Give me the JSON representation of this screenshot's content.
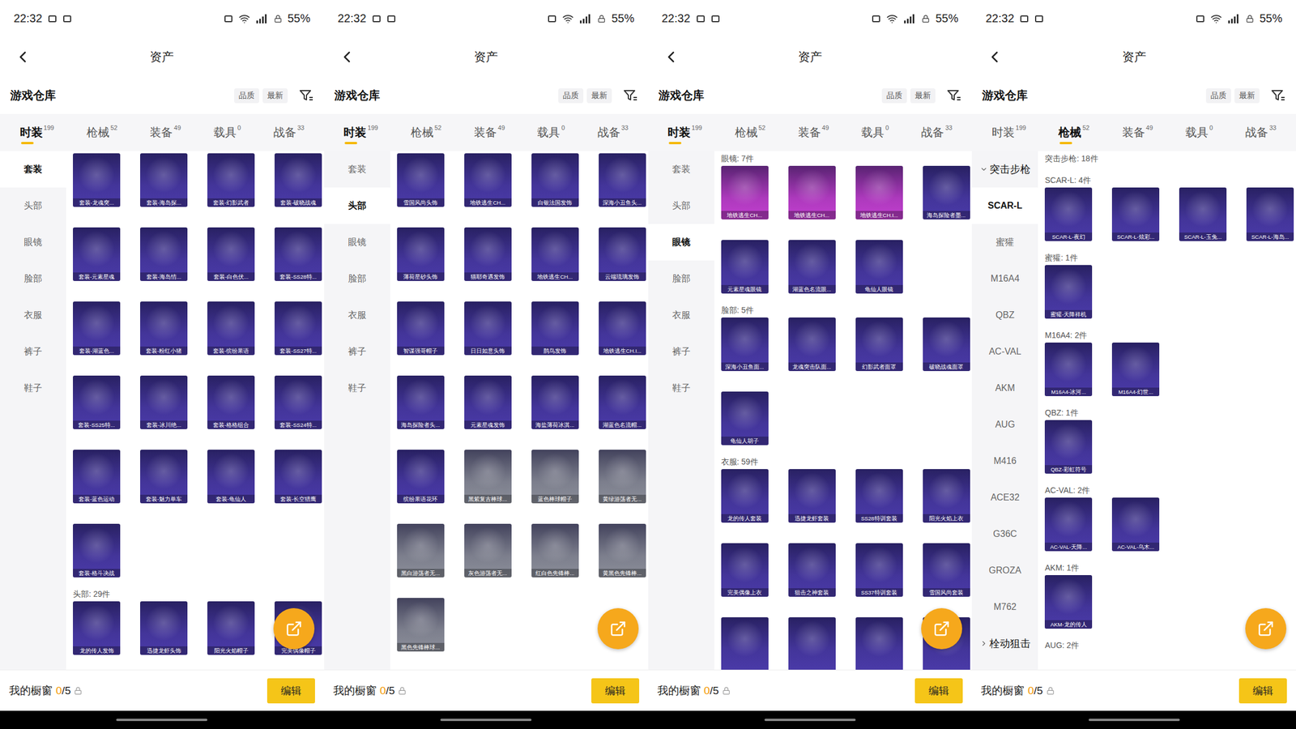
{
  "screens": [
    {
      "status_bar": {
        "time": "22:32",
        "battery": "55%"
      },
      "title": "资产",
      "section_title": "游戏仓库",
      "sort_buttons": [
        "品质",
        "最新"
      ],
      "tabs": [
        {
          "label": "时装",
          "count": "199",
          "selected": true
        },
        {
          "label": "枪械",
          "count": "52",
          "selected": false
        },
        {
          "label": "装备",
          "count": "49",
          "selected": false
        },
        {
          "label": "载具",
          "count": "0",
          "selected": false
        },
        {
          "label": "战备",
          "count": "33",
          "selected": false
        }
      ],
      "sidebar": [
        {
          "label": "套装",
          "kind": "item",
          "selected": true
        },
        {
          "label": "头部",
          "kind": "item",
          "selected": false
        },
        {
          "label": "眼镜",
          "kind": "item",
          "selected": false
        },
        {
          "label": "脸部",
          "kind": "item",
          "selected": false
        },
        {
          "label": "衣服",
          "kind": "item",
          "selected": false
        },
        {
          "label": "裤子",
          "kind": "item",
          "selected": false
        },
        {
          "label": "鞋子",
          "kind": "item",
          "selected": false
        }
      ],
      "content": [
        {
          "items": [
            {
              "label": "套装-龙魂突...",
              "color": "#4a3aa8"
            },
            {
              "label": "套装-海岛探...",
              "color": "#4a3aa8"
            },
            {
              "label": "套装-幻影武者",
              "color": "#4a3aa8"
            },
            {
              "label": "套装-破晓战魂",
              "color": "#4a3aa8"
            },
            {
              "label": "套装-元素星魂",
              "color": "#4a3aa8"
            },
            {
              "label": "套装-海岛情...",
              "color": "#4a3aa8"
            },
            {
              "label": "套装-白色伏...",
              "color": "#4a3aa8"
            },
            {
              "label": "套装-SS28特...",
              "color": "#4a3aa8"
            },
            {
              "label": "套装-湖蓝色...",
              "color": "#4a3aa8"
            },
            {
              "label": "套装-粉红小猪",
              "color": "#4a3aa8"
            },
            {
              "label": "套装-缤纷果语",
              "color": "#4a3aa8"
            },
            {
              "label": "套装-SS27特...",
              "color": "#4a3aa8"
            },
            {
              "label": "套装-SS25特...",
              "color": "#4a3aa8"
            },
            {
              "label": "套装-冰川绝...",
              "color": "#4a3aa8"
            },
            {
              "label": "套装-格格组合",
              "color": "#4a3aa8"
            },
            {
              "label": "套装-SS24特...",
              "color": "#4a3aa8"
            },
            {
              "label": "套装-蓝色运动",
              "color": "#4a3aa8"
            },
            {
              "label": "套装-魅力单车",
              "color": "#4a3aa8"
            },
            {
              "label": "套装-龟仙人",
              "color": "#4a3aa8"
            },
            {
              "label": "套装-长空猎鹰",
              "color": "#4a3aa8"
            },
            {
              "label": "套装-格斗决战",
              "color": "#4a3aa8"
            }
          ]
        },
        {
          "title": "头部: 29件",
          "items": [
            {
              "label": "龙的传人发饰",
              "color": "#4a3aa8"
            },
            {
              "label": "迅捷龙虾头饰",
              "color": "#4a3aa8"
            },
            {
              "label": "阳光火焰帽子",
              "color": "#4a3aa8"
            },
            {
              "label": "完美偶像帽子",
              "color": "#4a3aa8"
            }
          ]
        }
      ],
      "showcase": {
        "label": "我的橱窗",
        "count": "0",
        "total": "/5"
      },
      "edit_button": "编辑"
    },
    {
      "status_bar": {
        "time": "22:32",
        "battery": "55%"
      },
      "title": "资产",
      "section_title": "游戏仓库",
      "sort_buttons": [
        "品质",
        "最新"
      ],
      "tabs": [
        {
          "label": "时装",
          "count": "199",
          "selected": true
        },
        {
          "label": "枪械",
          "count": "52",
          "selected": false
        },
        {
          "label": "装备",
          "count": "49",
          "selected": false
        },
        {
          "label": "载具",
          "count": "0",
          "selected": false
        },
        {
          "label": "战备",
          "count": "33",
          "selected": false
        }
      ],
      "sidebar": [
        {
          "label": "套装",
          "kind": "item",
          "selected": false
        },
        {
          "label": "头部",
          "kind": "item",
          "selected": true
        },
        {
          "label": "眼镜",
          "kind": "item",
          "selected": false
        },
        {
          "label": "脸部",
          "kind": "item",
          "selected": false
        },
        {
          "label": "衣服",
          "kind": "item",
          "selected": false
        },
        {
          "label": "裤子",
          "kind": "item",
          "selected": false
        },
        {
          "label": "鞋子",
          "kind": "item",
          "selected": false
        }
      ],
      "content": [
        {
          "items": [
            {
              "label": "雪国风尚头饰",
              "color": "#4a3aa8"
            },
            {
              "label": "地铁逃生CH...",
              "color": "#4a3aa8"
            },
            {
              "label": "白银法国发饰",
              "color": "#4a3aa8"
            },
            {
              "label": "深海小丑鱼头...",
              "color": "#4a3aa8"
            },
            {
              "label": "薄荷星砂头饰",
              "color": "#4a3aa8"
            },
            {
              "label": "猫耶奇遇发饰",
              "color": "#4a3aa8"
            },
            {
              "label": "地铁逃生CH...",
              "color": "#4a3aa8"
            },
            {
              "label": "云端琉璃发饰",
              "color": "#4a3aa8"
            },
            {
              "label": "智谋强哥帽子",
              "color": "#4a3aa8"
            },
            {
              "label": "日日如意头饰",
              "color": "#4a3aa8"
            },
            {
              "label": "鹊鸟发饰",
              "color": "#4a3aa8"
            },
            {
              "label": "地铁逃生CH.I...",
              "color": "#4a3aa8"
            },
            {
              "label": "海岛探险者头...",
              "color": "#4a3aa8"
            },
            {
              "label": "元素星魂发饰",
              "color": "#4a3aa8"
            },
            {
              "label": "海盐薄荷冰淇...",
              "color": "#4a3aa8"
            },
            {
              "label": "湖蓝色名流帽...",
              "color": "#4a3aa8"
            },
            {
              "label": "缤纷果语花环",
              "color": "#4a3aa8"
            },
            {
              "label": "黑紫复古棒球...",
              "color": "#8b8e99"
            },
            {
              "label": "蓝色棒球帽子",
              "color": "#8b8e99"
            },
            {
              "label": "黄绿游荡者无...",
              "color": "#8b8e99"
            },
            {
              "label": "黑白游荡者无...",
              "color": "#8b8e99"
            },
            {
              "label": "灰色游荡者无...",
              "color": "#8b8e99"
            },
            {
              "label": "红白色先锋棒...",
              "color": "#8b8e99"
            },
            {
              "label": "黄黑色先锋棒...",
              "color": "#8b8e99"
            },
            {
              "label": "黑色先锋棒球...",
              "color": "#8b8e99"
            }
          ]
        }
      ],
      "showcase": {
        "label": "我的橱窗",
        "count": "0",
        "total": "/5"
      },
      "edit_button": "编辑"
    },
    {
      "status_bar": {
        "time": "22:32",
        "battery": "55%"
      },
      "title": "资产",
      "section_title": "游戏仓库",
      "sort_buttons": [
        "品质",
        "最新"
      ],
      "tabs": [
        {
          "label": "时装",
          "count": "199",
          "selected": true
        },
        {
          "label": "枪械",
          "count": "52",
          "selected": false
        },
        {
          "label": "装备",
          "count": "49",
          "selected": false
        },
        {
          "label": "载具",
          "count": "0",
          "selected": false
        },
        {
          "label": "战备",
          "count": "33",
          "selected": false
        }
      ],
      "sidebar": [
        {
          "label": "套装",
          "kind": "item",
          "selected": false
        },
        {
          "label": "头部",
          "kind": "item",
          "selected": false
        },
        {
          "label": "眼镜",
          "kind": "item",
          "selected": true
        },
        {
          "label": "脸部",
          "kind": "item",
          "selected": false
        },
        {
          "label": "衣服",
          "kind": "item",
          "selected": false
        },
        {
          "label": "裤子",
          "kind": "item",
          "selected": false
        },
        {
          "label": "鞋子",
          "kind": "item",
          "selected": false
        }
      ],
      "content": [
        {
          "title": "眼镜: 7件",
          "items": [
            {
              "label": "地铁逃生CH...",
              "color": "#c23fcf"
            },
            {
              "label": "地铁逃生CH...",
              "color": "#c23fcf"
            },
            {
              "label": "地铁逃生CH.I...",
              "color": "#c23fcf"
            },
            {
              "label": "海岛探险者墨...",
              "color": "#4a3aa8"
            },
            {
              "label": "元素星魂眼镜",
              "color": "#4a3aa8"
            },
            {
              "label": "湖蓝色名流眼...",
              "color": "#4a3aa8"
            },
            {
              "label": "龟仙人眼镜",
              "color": "#4a3aa8"
            }
          ]
        },
        {
          "title": "脸部: 5件",
          "items": [
            {
              "label": "深海小丑鱼面...",
              "color": "#4a3aa8"
            },
            {
              "label": "龙魂突击队面...",
              "color": "#4a3aa8"
            },
            {
              "label": "幻影武者面罩",
              "color": "#4a3aa8"
            },
            {
              "label": "破晓战魂面罩",
              "color": "#4a3aa8"
            },
            {
              "label": "龟仙人胡子",
              "color": "#4a3aa8"
            }
          ]
        },
        {
          "title": "衣服: 59件",
          "items": [
            {
              "label": "龙的传人套装",
              "color": "#4a3aa8"
            },
            {
              "label": "迅捷龙虾套装",
              "color": "#4a3aa8"
            },
            {
              "label": "SS28特训套装",
              "color": "#4a3aa8"
            },
            {
              "label": "阳光火焰上衣",
              "color": "#4a3aa8"
            },
            {
              "label": "完美偶像上衣",
              "color": "#4a3aa8"
            },
            {
              "label": "狙击之神套装",
              "color": "#4a3aa8"
            },
            {
              "label": "SS37特训套装",
              "color": "#4a3aa8"
            },
            {
              "label": "雪国风尚套装",
              "color": "#4a3aa8"
            },
            {
              "color": "#4a3aa8"
            },
            {
              "color": "#4a3aa8"
            },
            {
              "color": "#4a3aa8"
            },
            {
              "color": "#4a3aa8"
            }
          ]
        }
      ],
      "showcase": {
        "label": "我的橱窗",
        "count": "0",
        "total": "/5"
      },
      "edit_button": "编辑"
    },
    {
      "status_bar": {
        "time": "22:32",
        "battery": "55%"
      },
      "title": "资产",
      "section_title": "游戏仓库",
      "sort_buttons": [
        "品质",
        "最新"
      ],
      "tabs": [
        {
          "label": "时装",
          "count": "199",
          "selected": false
        },
        {
          "label": "枪械",
          "count": "52",
          "selected": true
        },
        {
          "label": "装备",
          "count": "49",
          "selected": false
        },
        {
          "label": "载具",
          "count": "0",
          "selected": false
        },
        {
          "label": "战备",
          "count": "33",
          "selected": false
        }
      ],
      "sidebar": [
        {
          "label": "突击步枪",
          "kind": "group",
          "expanded": true,
          "selected": false
        },
        {
          "label": "SCAR-L",
          "kind": "item",
          "selected": true
        },
        {
          "label": "蜜獾",
          "kind": "item",
          "selected": false
        },
        {
          "label": "M16A4",
          "kind": "item",
          "selected": false
        },
        {
          "label": "QBZ",
          "kind": "item",
          "selected": false
        },
        {
          "label": "AC-VAL",
          "kind": "item",
          "selected": false
        },
        {
          "label": "AKM",
          "kind": "item",
          "selected": false
        },
        {
          "label": "AUG",
          "kind": "item",
          "selected": false
        },
        {
          "label": "M416",
          "kind": "item",
          "selected": false
        },
        {
          "label": "ACE32",
          "kind": "item",
          "selected": false
        },
        {
          "label": "G36C",
          "kind": "item",
          "selected": false
        },
        {
          "label": "GROZA",
          "kind": "item",
          "selected": false
        },
        {
          "label": "M762",
          "kind": "item",
          "selected": false
        },
        {
          "label": "栓动狙击",
          "kind": "group",
          "expanded": false,
          "selected": false
        }
      ],
      "content": [
        {
          "title": "突击步枪: 18件"
        },
        {
          "title": "SCAR-L: 4件",
          "items": [
            {
              "label": "SCAR-L-夜幻",
              "color": "#4a3aa8"
            },
            {
              "label": "SCAR-L-炫彩...",
              "color": "#4a3aa8"
            },
            {
              "label": "SCAR-L-玉兔...",
              "color": "#4a3aa8"
            },
            {
              "label": "SCAR-L-海岛...",
              "color": "#4a3aa8"
            }
          ]
        },
        {
          "title": "蜜獾: 1件",
          "items": [
            {
              "label": "蜜獾-天降祥机",
              "color": "#4a3aa8"
            }
          ]
        },
        {
          "title": "M16A4: 2件",
          "items": [
            {
              "label": "M16A4-冰河...",
              "color": "#4a3aa8"
            },
            {
              "label": "M16A4-幻世...",
              "color": "#4a3aa8"
            }
          ]
        },
        {
          "title": "QBZ: 1件",
          "items": [
            {
              "label": "QBZ-彩虹符号",
              "color": "#4a3aa8"
            }
          ]
        },
        {
          "title": "AC-VAL: 2件",
          "items": [
            {
              "label": "AC-VAL-天降...",
              "color": "#4a3aa8"
            },
            {
              "label": "AC-VAL-乌木...",
              "color": "#4a3aa8"
            }
          ]
        },
        {
          "title": "AKM: 1件",
          "items": [
            {
              "label": "AKM-龙的传人",
              "color": "#4a3aa8"
            }
          ]
        },
        {
          "title": "AUG: 2件"
        }
      ],
      "showcase": {
        "label": "我的橱窗",
        "count": "0",
        "total": "/5"
      },
      "edit_button": "编辑"
    }
  ]
}
